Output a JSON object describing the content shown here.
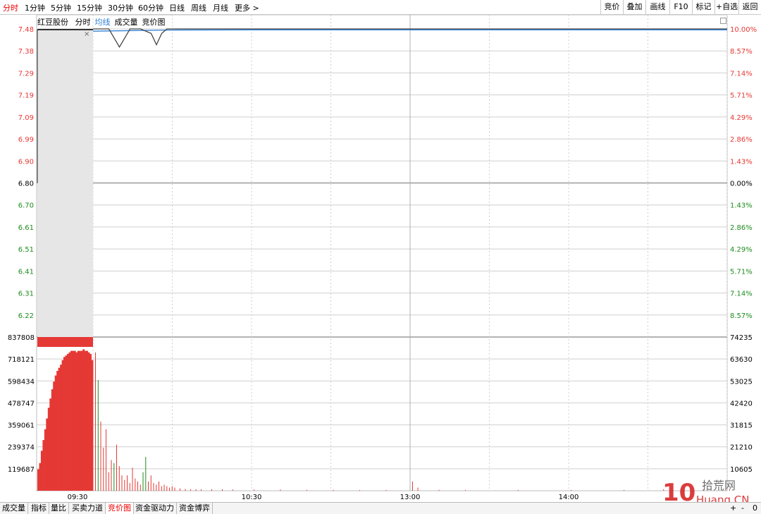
{
  "toolbar": {
    "tabs": [
      "分时",
      "1分钟",
      "5分钟",
      "15分钟",
      "30分钟",
      "60分钟",
      "日线",
      "周线",
      "月线",
      "更多 >"
    ],
    "active_tab": "分时",
    "right_buttons": [
      "竞价",
      "叠加",
      "画线",
      "F10",
      "标记",
      "+自选",
      "返回"
    ]
  },
  "legend": {
    "stock_name": "红豆股份",
    "items": [
      "分时",
      "均线",
      "成交量",
      "竞价图"
    ],
    "close_glyph": "×"
  },
  "colors": {
    "up": "#e53935",
    "down": "#1e8c1e",
    "price_line": "#444444",
    "avg_line": "#2e7fd6",
    "auction_bg": "#e6e6e6",
    "grid": "#cfcfcf"
  },
  "chart_data": {
    "type": "line",
    "price_ticks_left": [
      "7.48",
      "7.38",
      "7.29",
      "7.19",
      "7.09",
      "6.99",
      "6.90",
      "6.80",
      "6.70",
      "6.61",
      "6.51",
      "6.41",
      "6.31",
      "6.22"
    ],
    "pct_ticks_right": [
      "10.00%",
      "8.57%",
      "7.14%",
      "5.71%",
      "4.29%",
      "2.86%",
      "1.43%",
      "0.00%",
      "1.43%",
      "2.86%",
      "4.29%",
      "5.71%",
      "7.14%",
      "8.57%"
    ],
    "volume_ticks_left": [
      "837808",
      "718121",
      "598434",
      "478747",
      "359061",
      "239374",
      "119687"
    ],
    "volume_ticks_right": [
      "74235",
      "63630",
      "53025",
      "42420",
      "31815",
      "21210",
      "10605"
    ],
    "time_labels": [
      "09:30",
      "10:30",
      "13:00",
      "14:00"
    ],
    "prev_close": 6.8,
    "price_range": [
      6.12,
      7.48
    ],
    "price_series": {
      "name": "分时",
      "points": [
        [
          0,
          7.48
        ],
        [
          6,
          7.48
        ],
        [
          8,
          7.44
        ],
        [
          10,
          7.4
        ],
        [
          12,
          7.44
        ],
        [
          14,
          7.48
        ],
        [
          18,
          7.48
        ],
        [
          22,
          7.46
        ],
        [
          24,
          7.41
        ],
        [
          26,
          7.46
        ],
        [
          28,
          7.48
        ],
        [
          60,
          7.48
        ],
        [
          240,
          7.48
        ]
      ]
    },
    "avg_series": {
      "name": "均线",
      "points": [
        [
          0,
          7.47
        ],
        [
          30,
          7.475
        ],
        [
          60,
          7.476
        ],
        [
          240,
          7.476
        ]
      ]
    },
    "auction_volume_fraction": [
      0.14,
      0.18,
      0.26,
      0.33,
      0.4,
      0.47,
      0.54,
      0.6,
      0.66,
      0.71,
      0.75,
      0.78,
      0.8,
      0.82,
      0.85,
      0.87,
      0.88,
      0.89,
      0.9,
      0.91,
      0.91,
      0.91,
      0.9,
      0.91,
      0.91,
      0.91,
      0.92,
      0.91,
      0.91,
      0.9,
      0.89,
      0.85
    ],
    "volume_max": 74235,
    "volume_bars": [
      [
        0,
        1,
        0.9,
        "up"
      ],
      [
        1,
        1,
        0.72,
        "down"
      ],
      [
        2,
        1,
        0.45,
        "up"
      ],
      [
        3,
        1,
        0.28,
        "up"
      ],
      [
        4,
        1,
        0.4,
        "up"
      ],
      [
        5,
        1,
        0.12,
        "up"
      ],
      [
        6,
        1,
        0.2,
        "up"
      ],
      [
        7,
        1,
        0.18,
        "down"
      ],
      [
        8,
        1,
        0.3,
        "up"
      ],
      [
        9,
        1,
        0.16,
        "up"
      ],
      [
        10,
        1,
        0.1,
        "up"
      ],
      [
        11,
        1,
        0.07,
        "up"
      ],
      [
        12,
        1,
        0.1,
        "up"
      ],
      [
        13,
        1,
        0.05,
        "up"
      ],
      [
        14,
        1,
        0.15,
        "up"
      ],
      [
        15,
        1,
        0.08,
        "up"
      ],
      [
        16,
        1,
        0.06,
        "up"
      ],
      [
        17,
        1,
        0.04,
        "up"
      ],
      [
        18,
        1,
        0.12,
        "down"
      ],
      [
        19,
        1,
        0.22,
        "down"
      ],
      [
        20,
        1,
        0.06,
        "up"
      ],
      [
        21,
        1,
        0.1,
        "up"
      ],
      [
        22,
        1,
        0.05,
        "up"
      ],
      [
        23,
        1,
        0.04,
        "up"
      ],
      [
        24,
        1,
        0.06,
        "up"
      ],
      [
        25,
        1,
        0.03,
        "up"
      ],
      [
        26,
        1,
        0.04,
        "up"
      ],
      [
        27,
        1,
        0.03,
        "up"
      ],
      [
        28,
        1,
        0.02,
        "up"
      ],
      [
        29,
        1,
        0.03,
        "up"
      ],
      [
        30,
        1,
        0.02,
        "up"
      ],
      [
        32,
        1,
        0.015,
        "up"
      ],
      [
        34,
        1,
        0.012,
        "up"
      ],
      [
        36,
        1,
        0.01,
        "up"
      ],
      [
        38,
        1,
        0.01,
        "up"
      ],
      [
        40,
        1,
        0.01,
        "up"
      ],
      [
        44,
        1,
        0.01,
        "up"
      ],
      [
        48,
        1,
        0.01,
        "up"
      ],
      [
        52,
        1,
        0.008,
        "up"
      ],
      [
        60,
        1,
        0.008,
        "up"
      ],
      [
        70,
        1,
        0.008,
        "up"
      ],
      [
        80,
        1,
        0.006,
        "up"
      ],
      [
        90,
        1,
        0.006,
        "up"
      ],
      [
        100,
        1,
        0.005,
        "up"
      ],
      [
        110,
        1,
        0.005,
        "up"
      ],
      [
        120,
        1,
        0.06,
        "up"
      ],
      [
        122,
        1,
        0.02,
        "up"
      ],
      [
        130,
        1,
        0.006,
        "up"
      ],
      [
        140,
        1,
        0.005,
        "up"
      ],
      [
        160,
        1,
        0.005,
        "up"
      ],
      [
        180,
        1,
        0.005,
        "up"
      ],
      [
        200,
        1,
        0.005,
        "up"
      ],
      [
        215,
        1,
        0.01,
        "up"
      ],
      [
        230,
        1,
        0.008,
        "up"
      ],
      [
        240,
        1,
        0.01,
        "up"
      ]
    ]
  },
  "bottom_tabs": [
    "成交量",
    "指标",
    "量比",
    "买卖力道",
    "竞价图",
    "资金驱动力",
    "资金博弈"
  ],
  "active_bottom_tab": "竞价图",
  "watermark": {
    "line1": "拾荒网",
    "line2": "Huang.CN",
    "badge": "10"
  },
  "corner_controls": [
    "+",
    "-",
    "0"
  ]
}
